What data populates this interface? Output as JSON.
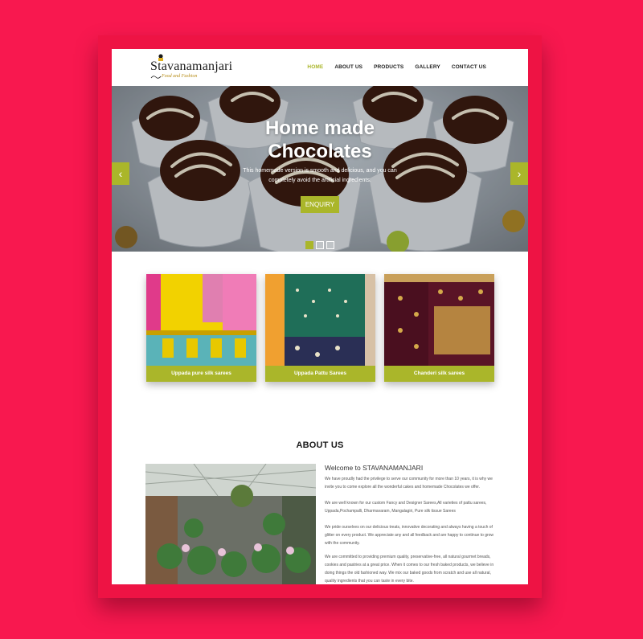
{
  "brand": {
    "name": "Stavanamanjari",
    "tagline": "Food and Fashion"
  },
  "nav": {
    "items": [
      {
        "label": "HOME",
        "active": true
      },
      {
        "label": "ABOUT US",
        "active": false
      },
      {
        "label": "PRODUCTS",
        "active": false
      },
      {
        "label": "GALLERY",
        "active": false
      },
      {
        "label": "CONTACT US",
        "active": false
      }
    ]
  },
  "hero": {
    "title_line1": "Home made",
    "title_line2": "Chocolates",
    "text": "This homemade version is smooth and delicious, and you can completely avoid the artificial ingredients.",
    "button_label": "ENQUIRY",
    "prev_icon": "chevron-left-icon",
    "next_icon": "chevron-right-icon",
    "slides_count": 3,
    "active_slide": 1
  },
  "products": [
    {
      "label": "Uppada pure silk sarees"
    },
    {
      "label": "Uppada Pattu Sarees"
    },
    {
      "label": "Chanderi silk sarees"
    }
  ],
  "about": {
    "heading": "ABOUT US",
    "subheading": "Welcome to STAVANAMANJARI",
    "paragraphs": [
      "We have proudly had the privilege to serve our community for more than 10 years, it is why we invite you to come explore all the wonderful cakes and homemade Chocolates we offer.",
      "We are well known for our custom Fancy and Designer Sarees,All varieties of pattu sarees, Uppada,Pochampalli, Dharmavaram, Mangalagiri, Pure silk tissue Sarees",
      "We pride ourselves on our delicious treats, innovative decorating and always having a touch of glitter on every product. We appreciate any and all feedback and are happy to continue to grow with the community.",
      "We are committed to providing premium quality, preservative-free, all natural gourmet breads, cookies and pastries at a great price. When it comes to our fresh baked products, we believe in doing things the old fashioned way. We mix our baked goods from scratch and use all natural, quality ingredients that you can taste in every bite."
    ]
  },
  "colors": {
    "background": "#f8184f",
    "accent": "#aab62a",
    "text_dark": "#1a1a1a"
  }
}
